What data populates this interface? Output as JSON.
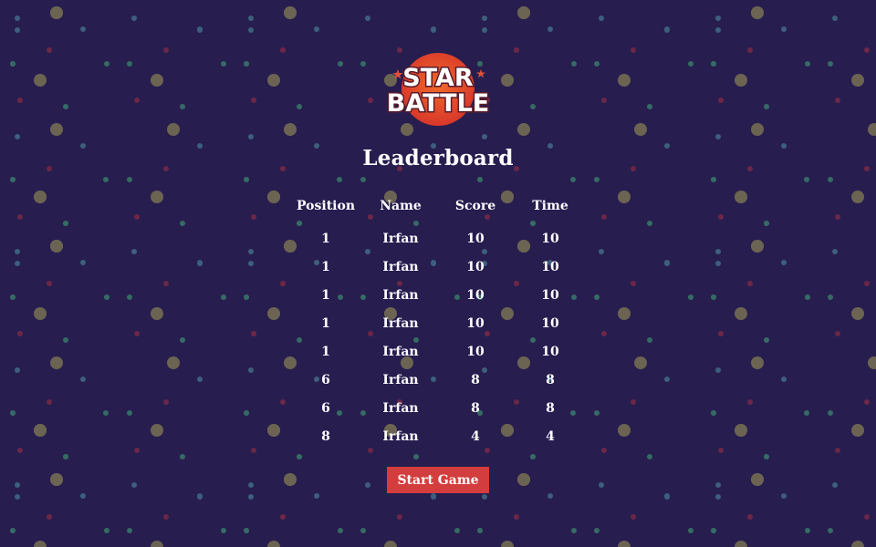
{
  "logo": {
    "line1": "STAR",
    "line2": "BATTLE"
  },
  "leaderboard": {
    "title": "Leaderboard",
    "columns": {
      "position": "Position",
      "name": "Name",
      "score": "Score",
      "time": "Time"
    },
    "rows": [
      {
        "position": "1",
        "name": "Irfan",
        "score": "10",
        "time": "10"
      },
      {
        "position": "1",
        "name": "Irfan",
        "score": "10",
        "time": "10"
      },
      {
        "position": "1",
        "name": "Irfan",
        "score": "10",
        "time": "10"
      },
      {
        "position": "1",
        "name": "Irfan",
        "score": "10",
        "time": "10"
      },
      {
        "position": "1",
        "name": "Irfan",
        "score": "10",
        "time": "10"
      },
      {
        "position": "6",
        "name": "Irfan",
        "score": "8",
        "time": "8"
      },
      {
        "position": "6",
        "name": "Irfan",
        "score": "8",
        "time": "8"
      },
      {
        "position": "8",
        "name": "Irfan",
        "score": "4",
        "time": "4"
      }
    ]
  },
  "start_button": {
    "label": "Start Game"
  },
  "colors": {
    "background": "#271d4f",
    "button": "#d43d3d",
    "text": "#ffffff",
    "logo_orb": "#e8452f",
    "dot_large": "#6b6452",
    "dot_blue": "#3d5f7d",
    "dot_green": "#356b64",
    "dot_red": "#6b2648"
  }
}
